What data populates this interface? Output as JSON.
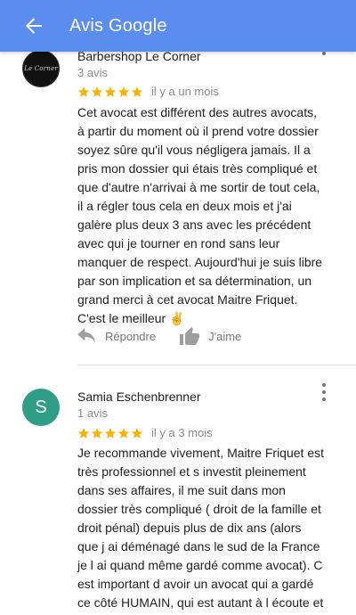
{
  "appbar": {
    "title": "Avis Google",
    "back_icon": "arrow-back-icon"
  },
  "colors": {
    "appbar": "#5b8def",
    "star": "#f6b400",
    "avatar_s": "#2e9e86"
  },
  "reviews": [
    {
      "author": "Barbershop Le Corner",
      "avatar_text": "Le Corner",
      "count": "3 avis",
      "rating": 5,
      "date": "il y a un mois",
      "text": "Cet avocat est différent des autres avocats,\nà partir du moment où il prend votre dossier\nsoyez sûre qu'il vous négligera jamais. Il a\npris mon dossier qui étais très compliqué et\nque d'autre n'arrivai à me sortir de tout cela,\nil a régler tous cela en deux mois et j'ai\ngalère plus deux 3 ans avec les précédent\navec qui je tourner en rond sans leur\nmanquer de respect. Aujourd'hui je suis libre\npar son implication et sa détermination, un\ngrand merci à cet avocat Maitre Friquet.\nC'est le meilleur ✌️",
      "reply_label": "Répondre",
      "like_label": "J'aime"
    },
    {
      "author": "Samia Eschenbrenner",
      "avatar_text": "S",
      "count": "1 avis",
      "rating": 5,
      "date": "il y a 3 mois",
      "text": "Je recommande vivement, Maitre Friquet est\ntrès professionnel et s investit pleinement\ndans ses affaires, il me suit dans mon\ndossier très compliqué ( droit de la famille et\ndroit pénal) depuis plus de dix ans (alors\nque j ai déménagé dans le sud de la France\nje l ai quand même gardé comme avocat). C\nest important d avoir un avocat qui a gardé\nce côté HUMAIN, qui est autant à l écoute et\nconciliant! Merci pour tout Maître Friquet !"
    }
  ]
}
